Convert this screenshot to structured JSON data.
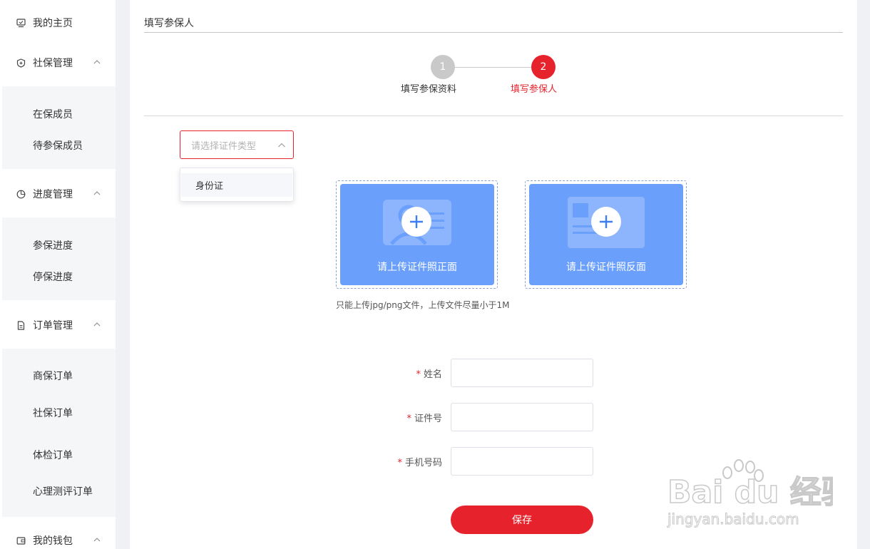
{
  "sidebar": {
    "home": {
      "label": "我的主页",
      "icon": "home-icon"
    },
    "social": {
      "label": "社保管理",
      "icon": "shield-plus-icon",
      "items": [
        "在保成员",
        "待参保成员"
      ]
    },
    "progress": {
      "label": "进度管理",
      "icon": "pie-chart-icon",
      "items": [
        "参保进度",
        "停保进度"
      ]
    },
    "orders": {
      "label": "订单管理",
      "icon": "document-icon",
      "items": [
        "商保订单",
        "社保订单",
        "体检订单",
        "心理测评订单"
      ]
    },
    "wallet": {
      "label": "我的钱包",
      "icon": "wallet-icon"
    }
  },
  "main": {
    "title": "填写参保人",
    "steps": [
      {
        "number": "1",
        "label": "填写参保资料",
        "state": "done",
        "color": "#c9c9c9"
      },
      {
        "number": "2",
        "label": "填写参保人",
        "state": "active",
        "color": "#e6232c"
      }
    ],
    "id_type_select": {
      "placeholder": "请选择证件类型",
      "options": [
        "身份证"
      ]
    },
    "upload": {
      "front_label": "请上传证件照正面",
      "back_label": "请上传证件照反面",
      "hint": "只能上传jpg/png文件，上传文件尽量小于1M"
    },
    "form": {
      "required_mark": "*",
      "name_label": "姓名",
      "id_label": "证件号",
      "phone_label": "手机号码",
      "save_label": "保存"
    }
  },
  "watermark": {
    "brand": "Bai du 经验",
    "url": "jingyan.baidu.com"
  },
  "colors": {
    "accent": "#e6232c",
    "upload_bg": "#6a9ffc",
    "page_bg": "#f0f1f4"
  }
}
